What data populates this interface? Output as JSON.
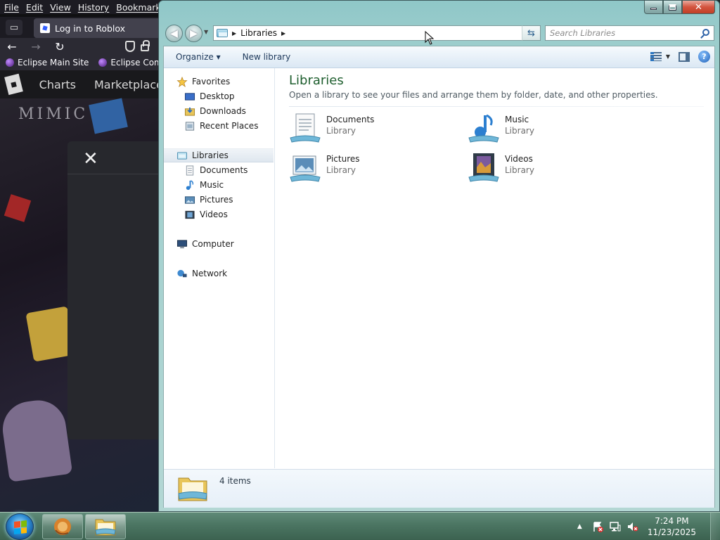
{
  "firefox": {
    "menu": [
      "File",
      "Edit",
      "View",
      "History",
      "Bookmarks"
    ],
    "tab_title": "Log in to Roblox",
    "bookmarks": [
      "Eclipse Main Site",
      "Eclipse Community"
    ],
    "page": {
      "nav": [
        "Charts",
        "Marketplace"
      ],
      "art_text": "MIMIC",
      "modal_close": "✕"
    }
  },
  "explorer": {
    "address": {
      "location": "Libraries",
      "search_placeholder": "Search Libraries"
    },
    "toolbar": {
      "organize": "Organize ▾",
      "new_library": "New library",
      "help": "?"
    },
    "nav_pane": {
      "favorites": "Favorites",
      "favorite_items": [
        "Desktop",
        "Downloads",
        "Recent Places"
      ],
      "libraries": "Libraries",
      "library_items": [
        "Documents",
        "Music",
        "Pictures",
        "Videos"
      ],
      "computer": "Computer",
      "network": "Network"
    },
    "content": {
      "heading": "Libraries",
      "description": "Open a library to see your files and arrange them by folder, date, and other properties.",
      "items": [
        {
          "name": "Documents",
          "type": "Library"
        },
        {
          "name": "Music",
          "type": "Library"
        },
        {
          "name": "Pictures",
          "type": "Library"
        },
        {
          "name": "Videos",
          "type": "Library"
        }
      ]
    },
    "details": {
      "count": "4 items"
    }
  },
  "taskbar": {
    "clock_time": "7:24 PM",
    "clock_date": "11/23/2025"
  },
  "colors": {
    "heading_green": "#1e5e2e",
    "link_blue": "#1e395b",
    "taskbar": "#4b7562"
  }
}
